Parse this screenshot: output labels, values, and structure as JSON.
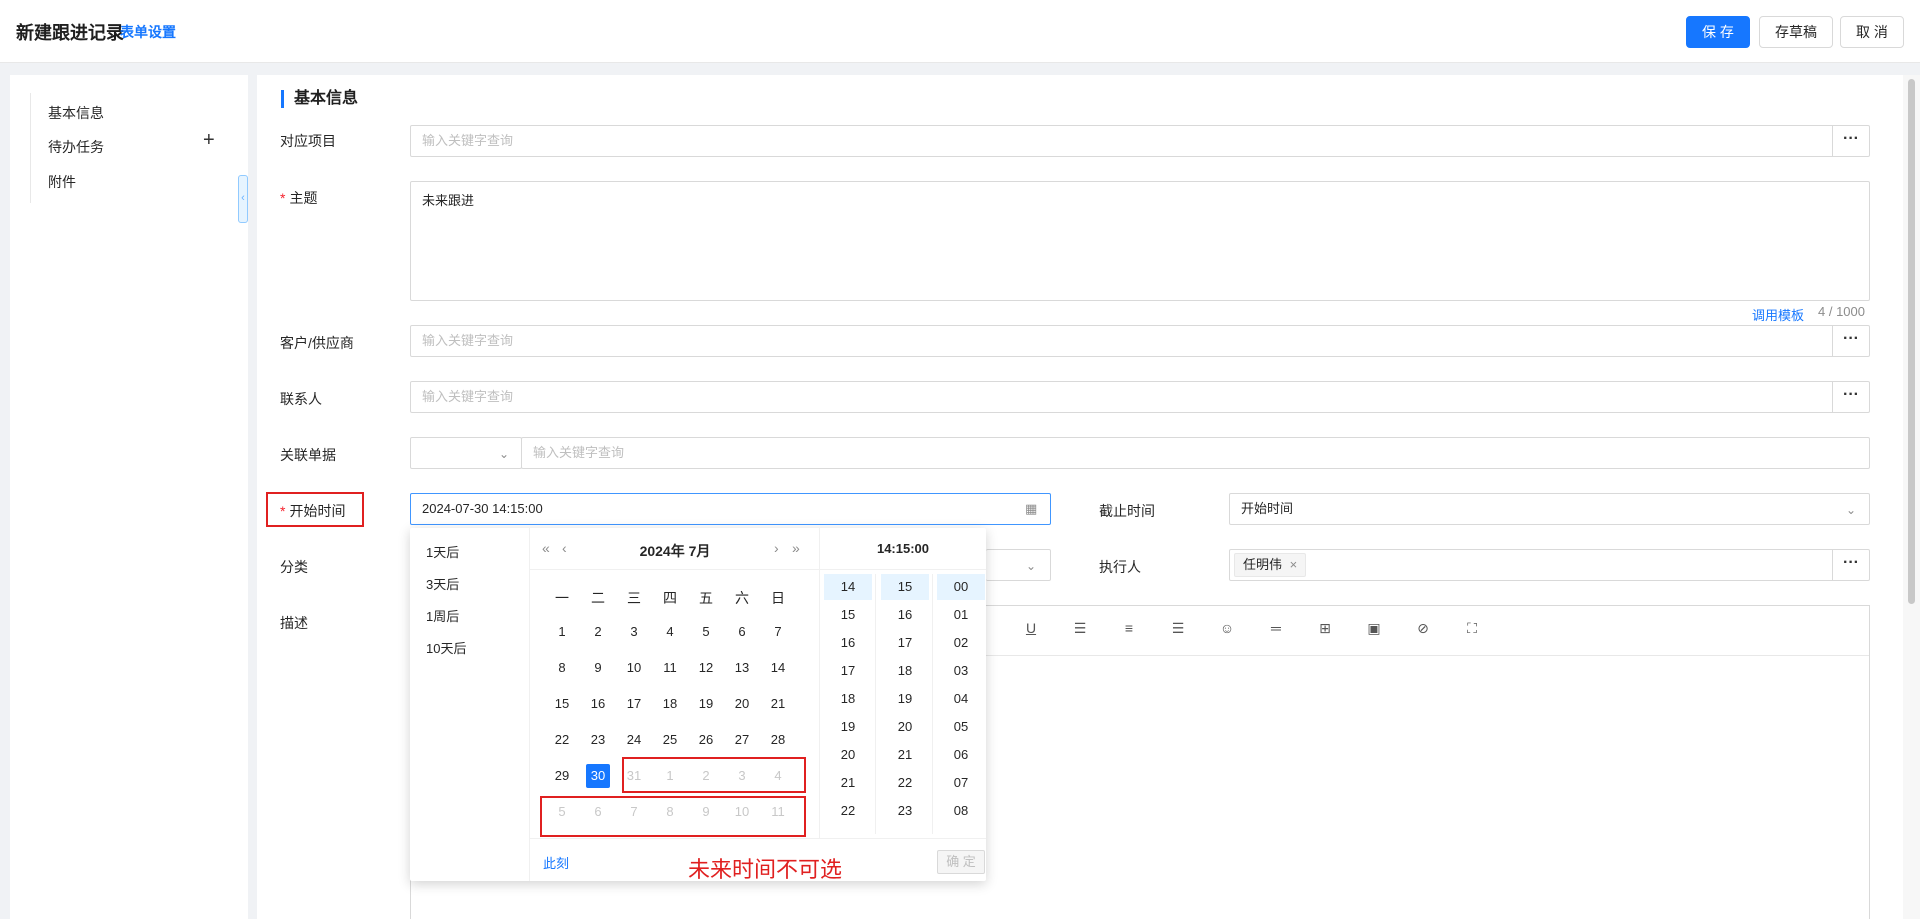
{
  "header": {
    "title": "新建跟进记录",
    "form_settings": "表单设置",
    "save": "保 存",
    "draft": "存草稿",
    "cancel": "取 消"
  },
  "sidebar": {
    "items": [
      {
        "label": "基本信息"
      },
      {
        "label": "待办任务"
      },
      {
        "label": "附件"
      }
    ],
    "plus": "+"
  },
  "section": {
    "title": "基本信息"
  },
  "fields": {
    "project": {
      "label": "对应项目",
      "placeholder": "输入关键字查询"
    },
    "subject": {
      "label": "主题",
      "required": "*",
      "value": "未来跟进",
      "template_link": "调用模板",
      "counter": "4 / 1000"
    },
    "customer": {
      "label": "客户/供应商",
      "placeholder": "输入关键字查询"
    },
    "contact": {
      "label": "联系人",
      "placeholder": "输入关键字查询"
    },
    "related_doc": {
      "label": "关联单据",
      "placeholder": "输入关键字查询"
    },
    "start_time": {
      "label": "开始时间",
      "required": "*",
      "value": "2024-07-30 14:15:00"
    },
    "deadline": {
      "label": "截止时间",
      "value": "开始时间"
    },
    "category": {
      "label": "分类"
    },
    "executor": {
      "label": "执行人",
      "tag": "任明伟",
      "tag_close": "×"
    },
    "description": {
      "label": "描述"
    }
  },
  "dots": "···",
  "editor_tools": [
    "underline-icon",
    "align-left-icon",
    "align-center-icon",
    "align-right-icon",
    "emoji-icon",
    "divider-icon",
    "table-icon",
    "image-icon",
    "attachment-icon",
    "fullscreen-icon"
  ],
  "picker": {
    "presets": [
      "1天后",
      "3天后",
      "1周后",
      "10天后"
    ],
    "title": "2024年  7月",
    "nav": {
      "prev_year": "«",
      "prev_month": "‹",
      "next_month": "›",
      "next_year": "»"
    },
    "weekdays": [
      "一",
      "二",
      "三",
      "四",
      "五",
      "六",
      "日"
    ],
    "weeks": [
      [
        "1",
        "2",
        "3",
        "4",
        "5",
        "6",
        "7"
      ],
      [
        "8",
        "9",
        "10",
        "11",
        "12",
        "13",
        "14"
      ],
      [
        "15",
        "16",
        "17",
        "18",
        "19",
        "20",
        "21"
      ],
      [
        "22",
        "23",
        "24",
        "25",
        "26",
        "27",
        "28"
      ],
      [
        "29",
        "30",
        "31",
        "1",
        "2",
        "3",
        "4"
      ],
      [
        "5",
        "6",
        "7",
        "8",
        "9",
        "10",
        "11"
      ]
    ],
    "selected_day": "30",
    "time_header": "14:15:00",
    "hours": [
      "14",
      "15",
      "16",
      "17",
      "18",
      "19",
      "20",
      "21",
      "22"
    ],
    "minutes": [
      "15",
      "16",
      "17",
      "18",
      "19",
      "20",
      "21",
      "22",
      "23"
    ],
    "seconds": [
      "00",
      "01",
      "02",
      "03",
      "04",
      "05",
      "06",
      "07",
      "08"
    ],
    "now": "此刻",
    "ok": "确 定"
  },
  "annotation": "未来时间不可选"
}
